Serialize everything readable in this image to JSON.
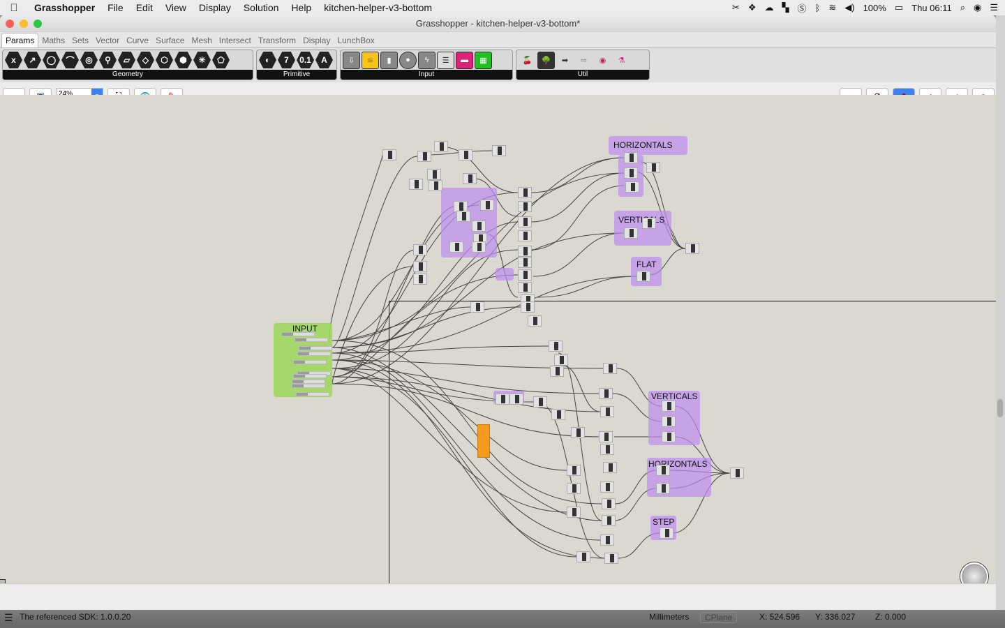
{
  "menubar": {
    "apple": "",
    "items": [
      "Grasshopper",
      "File",
      "Edit",
      "View",
      "Display",
      "Solution",
      "Help",
      "kitchen-helper-v3-bottom"
    ],
    "battery": "100%",
    "clock": "Thu 06:11"
  },
  "window": {
    "title": "Grasshopper - kitchen-helper-v3-bottom*"
  },
  "tabs": [
    "Params",
    "Maths",
    "Sets",
    "Vector",
    "Curve",
    "Surface",
    "Mesh",
    "Intersect",
    "Transform",
    "Display",
    "LunchBox"
  ],
  "ribbon": {
    "panels": [
      {
        "label": "Geometry",
        "icons": [
          "x",
          "↗",
          "◯",
          "⌒",
          "◎",
          "⚲",
          "▱",
          "◇",
          "⬡",
          "⬢",
          "✳",
          "⬠"
        ]
      },
      {
        "label": "Primitive",
        "icons": [
          "◐",
          "7",
          "0.1",
          "A"
        ]
      },
      {
        "label": "Input",
        "icons": [
          "⇩",
          "≋",
          "▮",
          "●",
          "ϟ",
          "☰",
          "▬",
          "▦"
        ]
      },
      {
        "label": "Util",
        "icons": [
          "🍒",
          "🌳",
          "➡",
          "⇨",
          "◉",
          "⚗"
        ]
      }
    ]
  },
  "toolbar": {
    "zoom_value": "24%",
    "open_icon": "folder-icon",
    "save_icon": "save-icon",
    "zoom_extents_icon": "zoom-extents-icon",
    "preview_icon": "eye-icon",
    "sketch_icon": "sketch-icon"
  },
  "canvas": {
    "groups": [
      {
        "title": "INPUT",
        "color": "#a6d86a"
      },
      {
        "title": "HORIZONTALS",
        "color": "#c49af0"
      },
      {
        "title": "VERTICALS",
        "color": "#c49af0"
      },
      {
        "title": "FLAT",
        "color": "#c49af0"
      },
      {
        "title": "VERTICALS",
        "color": "#c49af0"
      },
      {
        "title": "HORIZONTALS",
        "color": "#c49af0"
      },
      {
        "title": "STEP",
        "color": "#c49af0"
      }
    ]
  },
  "statusbar": {
    "message": "The referenced SDK: 1.0.0.20",
    "units": "Millimeters",
    "cplane": "CPlane",
    "x": "X: 524.596",
    "y": "Y: 336.027",
    "z": "Z: 0.000"
  }
}
